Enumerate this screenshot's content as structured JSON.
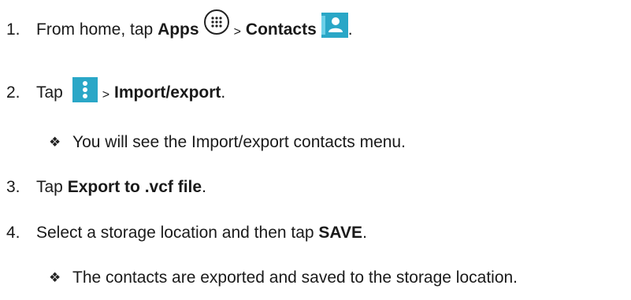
{
  "steps": [
    {
      "number": "1.",
      "text_before": "From home, tap ",
      "bold_1": "Apps",
      "icon_1": "apps-grid-icon",
      "separator": ">",
      "bold_2": "Contacts",
      "icon_2": "contacts-person-icon",
      "text_after": "."
    },
    {
      "number": "2.",
      "text_before": "Tap ",
      "icon_1": "overflow-menu-icon",
      "separator": ">",
      "bold_1": "Import/export",
      "text_after": "."
    },
    {
      "number": "3.",
      "text_before": "Tap ",
      "bold_1": "Export to .vcf file",
      "text_after": "."
    },
    {
      "number": "4.",
      "text_before": "Select a storage location and then tap ",
      "bold_1": "SAVE",
      "text_after": "."
    }
  ],
  "notes": [
    {
      "bullet": "❖",
      "text": "You will see the Import/export contacts menu."
    },
    {
      "bullet": "❖",
      "text": "The contacts are exported and saved to the storage location."
    }
  ],
  "colors": {
    "icon_teal": "#2aa7c7",
    "text": "#1a1a1a"
  }
}
